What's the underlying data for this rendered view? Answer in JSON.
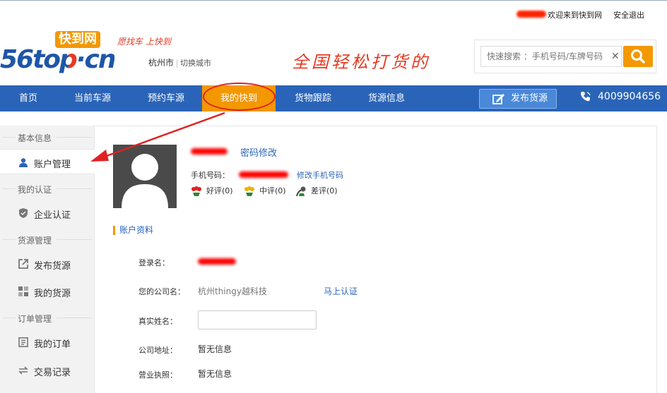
{
  "topbar": {
    "welcome": "欢迎来到快到网",
    "logout": "安全退出"
  },
  "header": {
    "logo_text": "56top·cn",
    "logo_tag": "快到网",
    "slogan": "愿找车 上快到",
    "city": "杭州市",
    "city_switch": "切换城市",
    "banner": "全国轻松打货的",
    "search_placeholder": "快速搜索 ：手机号码/车牌号码"
  },
  "nav": {
    "items": [
      "首页",
      "当前车源",
      "预约车源",
      "我的快到",
      "货物跟踪",
      "货源信息"
    ],
    "active": "我的快到",
    "publish": "发布货源",
    "phone": "4009904656"
  },
  "sidebar": {
    "sections": [
      {
        "title": "基本信息",
        "items": [
          {
            "label": "账户管理",
            "icon": "user-icon"
          }
        ]
      },
      {
        "title": "我的认证",
        "items": [
          {
            "label": "企业认证",
            "icon": "shield-icon"
          }
        ]
      },
      {
        "title": "货源管理",
        "items": [
          {
            "label": "发布货源",
            "icon": "external-link-icon"
          },
          {
            "label": "我的货源",
            "icon": "grid-icon"
          }
        ]
      },
      {
        "title": "订单管理",
        "items": [
          {
            "label": "我的订单",
            "icon": "document-icon"
          },
          {
            "label": "交易记录",
            "icon": "swap-icon"
          }
        ]
      }
    ]
  },
  "profile": {
    "password_change": "密码修改",
    "phone_label": "手机号码：",
    "phone_change": "修改手机号码",
    "ratings": [
      {
        "label": "好评(0)",
        "icon": "flower-red-icon"
      },
      {
        "label": "中评(0)",
        "icon": "flower-yellow-icon"
      },
      {
        "label": "差评(0)",
        "icon": "wilted-icon"
      }
    ]
  },
  "account": {
    "section_title": "账户资料",
    "login_label": "登录名：",
    "company_label": "您的公司名：",
    "company_value": "杭州thingy越科技",
    "verify_link": "马上认证",
    "realname_label": "真实姓名：",
    "address_label": "公司地址：",
    "address_value": "暂无信息",
    "license_label": "营业执照：",
    "license_value": "暂无信息"
  },
  "colors": {
    "nav_bg": "#2a64b8",
    "accent": "#f39800",
    "link": "#2a64b8",
    "annotation": "#e02020"
  }
}
